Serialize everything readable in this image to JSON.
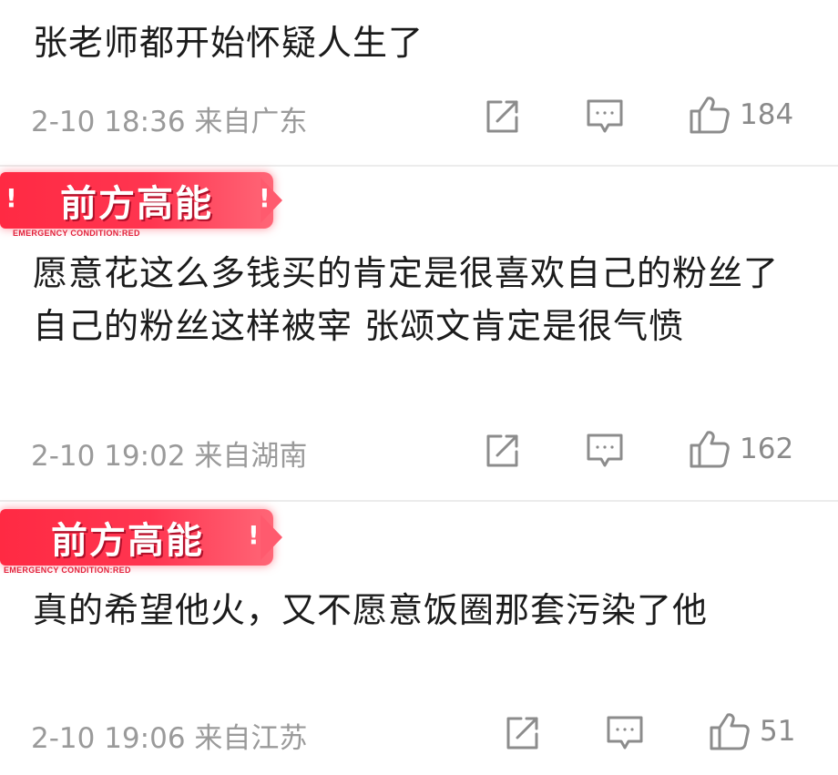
{
  "comments": [
    {
      "badge": null,
      "text": "张老师都开始怀疑人生了",
      "meta": "2-10 18:36 来自广东",
      "likes": "184"
    },
    {
      "badge": {
        "title": "前方高能",
        "bang": "!",
        "sub": "EMERGENCY  CONDITION:RED"
      },
      "text": "愿意花这么多钱买的肯定是很喜欢自己的粉丝了 自己的粉丝这样被宰 张颂文肯定是很气愤",
      "meta": "2-10 19:02 来自湖南",
      "likes": "162"
    },
    {
      "badge": {
        "title": "前方高能",
        "bang": "!",
        "sub": "EMERGENCY  CONDITION:RED"
      },
      "text": "真的希望他火，又不愿意饭圈那套污染了他",
      "meta": "2-10 19:06 来自江苏",
      "likes": "51"
    }
  ],
  "icons": {
    "share": "share-icon",
    "comment": "comment-icon",
    "like": "thumbs-up-icon"
  },
  "colors": {
    "badge_red": "#ff2a43",
    "meta_gray": "#9a9a9a",
    "icon_gray": "#8c8c8c"
  }
}
